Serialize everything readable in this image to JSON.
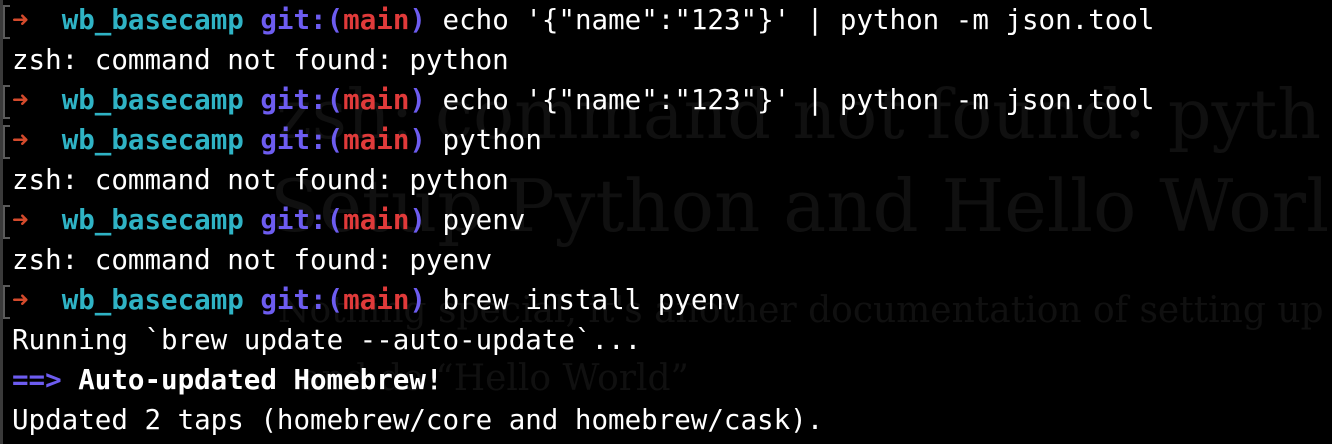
{
  "terminal": {
    "prompt_arrow": "➜",
    "directory": "wb_basecamp",
    "git_prefix": "git:(",
    "branch": "main",
    "git_suffix": ")",
    "lines": [
      {
        "type": "prompt",
        "command": "echo '{\"name\":\"123\"}' | python -m json.tool"
      },
      {
        "type": "output",
        "text": "zsh: command not found: python"
      },
      {
        "type": "prompt",
        "command": "echo '{\"name\":\"123\"}' | python -m json.tool"
      },
      {
        "type": "prompt",
        "command": "python"
      },
      {
        "type": "output",
        "text": "zsh: command not found: python"
      },
      {
        "type": "prompt",
        "command": "pyenv"
      },
      {
        "type": "output",
        "text": "zsh: command not found: pyenv"
      },
      {
        "type": "prompt",
        "command": "brew install pyenv"
      },
      {
        "type": "output",
        "text": "Running `brew update --auto-update`..."
      },
      {
        "type": "homebrew",
        "arrow": "==>",
        "text": "Auto-updated Homebrew!"
      },
      {
        "type": "output",
        "text": "Updated 2 taps (homebrew/core and homebrew/cask)."
      }
    ]
  },
  "background_page": {
    "line_1": "zsh: command not found: pyth",
    "line_2": "Setup Python and Hello Worl",
    "line_3": "Nothing special, it's another documentation of setting up",
    "line_4": "and do “Hello World”"
  },
  "colors": {
    "background": "#000000",
    "prompt_arrow": "#d44a2c",
    "directory": "#2fb3c5",
    "git_keyword": "#6d5cf0",
    "branch": "#e03a3a",
    "text": "#ffffff"
  }
}
